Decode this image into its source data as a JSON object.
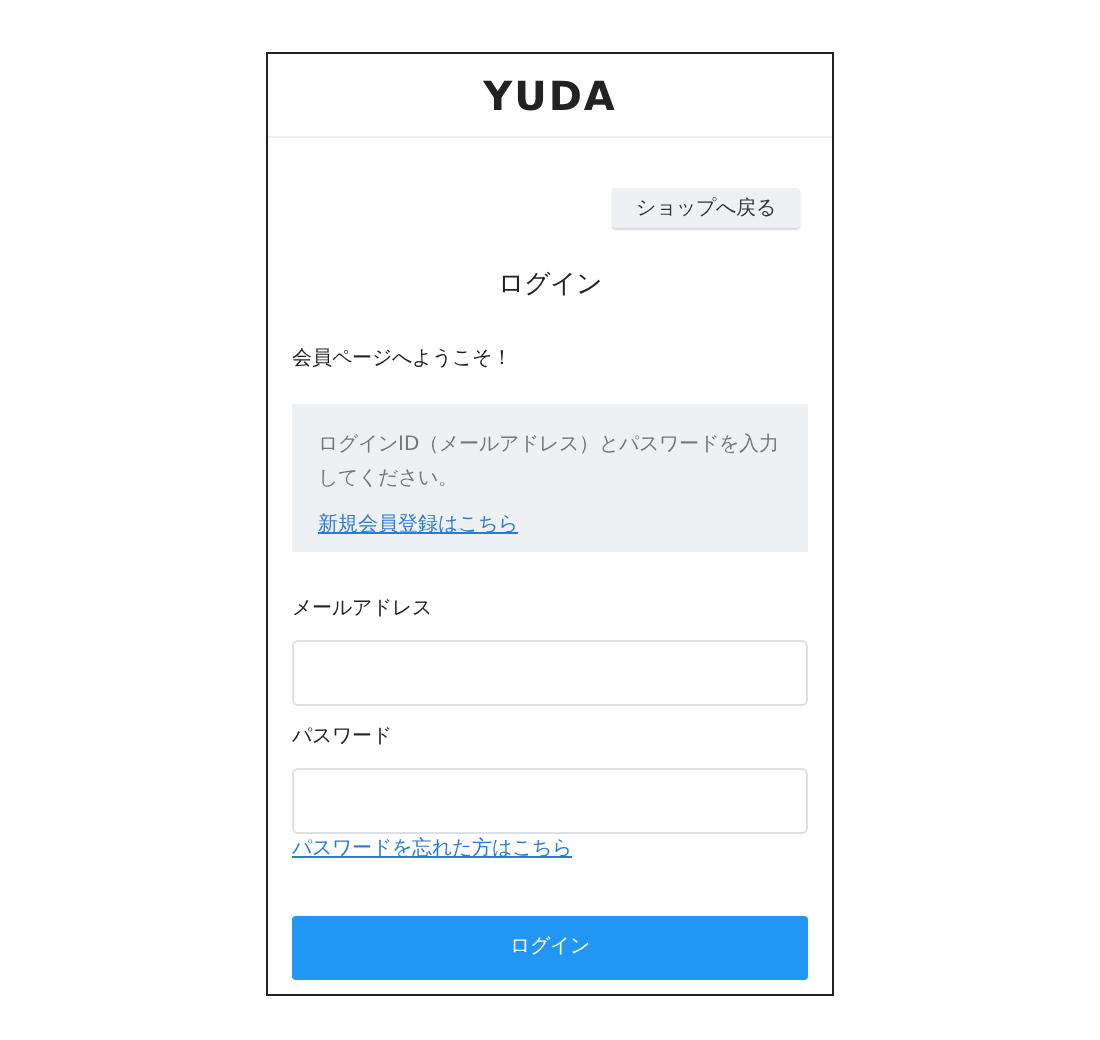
{
  "header": {
    "logo": "YUDA"
  },
  "back_button": "ショップへ戻る",
  "title": "ログイン",
  "welcome": "会員ページへようこそ！",
  "notice": {
    "text": "ログインID（メールアドレス）とパスワードを入力してください。",
    "link": "新規会員登録はこちら"
  },
  "fields": [
    {
      "label": "メールアドレス"
    },
    {
      "label": "パスワード"
    }
  ],
  "forgot_link": "パスワードを忘れた方はこちら",
  "submit_button": "ログイン"
}
